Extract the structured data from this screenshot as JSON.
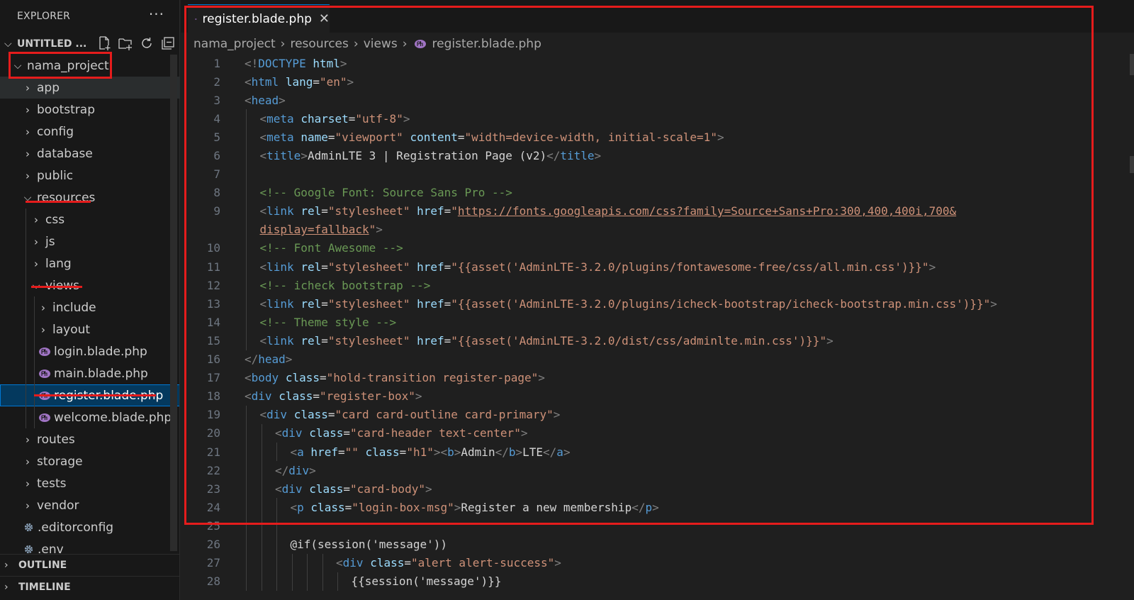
{
  "explorer": {
    "title": "EXPLORER",
    "more_label": "···",
    "workspace_name": "UNTITLED ...",
    "tree": [
      {
        "label": "nama_project",
        "kind": "folder",
        "open": true,
        "depth": 0
      },
      {
        "label": "app",
        "kind": "folder",
        "open": false,
        "depth": 1
      },
      {
        "label": "bootstrap",
        "kind": "folder",
        "open": false,
        "depth": 1
      },
      {
        "label": "config",
        "kind": "folder",
        "open": false,
        "depth": 1
      },
      {
        "label": "database",
        "kind": "folder",
        "open": false,
        "depth": 1
      },
      {
        "label": "public",
        "kind": "folder",
        "open": false,
        "depth": 1
      },
      {
        "label": "resources",
        "kind": "folder",
        "open": true,
        "depth": 1
      },
      {
        "label": "css",
        "kind": "folder",
        "open": false,
        "depth": 2
      },
      {
        "label": "js",
        "kind": "folder",
        "open": false,
        "depth": 2
      },
      {
        "label": "lang",
        "kind": "folder",
        "open": false,
        "depth": 2
      },
      {
        "label": "views",
        "kind": "folder",
        "open": true,
        "depth": 2
      },
      {
        "label": "include",
        "kind": "folder",
        "open": false,
        "depth": 3
      },
      {
        "label": "layout",
        "kind": "folder",
        "open": false,
        "depth": 3
      },
      {
        "label": "login.blade.php",
        "kind": "php",
        "depth": 3
      },
      {
        "label": "main.blade.php",
        "kind": "php",
        "depth": 3
      },
      {
        "label": "register.blade.php",
        "kind": "php",
        "depth": 3,
        "selected": true
      },
      {
        "label": "welcome.blade.php",
        "kind": "php",
        "depth": 3
      },
      {
        "label": "routes",
        "kind": "folder",
        "open": false,
        "depth": 1
      },
      {
        "label": "storage",
        "kind": "folder",
        "open": false,
        "depth": 1
      },
      {
        "label": "tests",
        "kind": "folder",
        "open": false,
        "depth": 1
      },
      {
        "label": "vendor",
        "kind": "folder",
        "open": false,
        "depth": 1
      },
      {
        "label": ".editorconfig",
        "kind": "config",
        "depth": 1
      },
      {
        "label": ".env",
        "kind": "config",
        "depth": 1
      }
    ],
    "outline_label": "OUTLINE",
    "timeline_label": "TIMELINE"
  },
  "editor": {
    "tab_label": "register.blade.php",
    "tab_close": "✕",
    "breadcrumb": [
      "nama_project",
      "resources",
      "views",
      "register.blade.php"
    ],
    "lines": [
      {
        "n": "1",
        "indent": 0,
        "tokens": [
          [
            "p",
            "<!"
          ],
          [
            "t",
            "DOCTYPE"
          ],
          [
            "x",
            " "
          ],
          [
            "a",
            "html"
          ],
          [
            "p",
            ">"
          ]
        ]
      },
      {
        "n": "2",
        "indent": 0,
        "tokens": [
          [
            "p",
            "<"
          ],
          [
            "t",
            "html"
          ],
          [
            "x",
            " "
          ],
          [
            "a",
            "lang"
          ],
          [
            "x",
            "="
          ],
          [
            "s",
            "\"en\""
          ],
          [
            "p",
            ">"
          ]
        ]
      },
      {
        "n": "3",
        "indent": 0,
        "tokens": [
          [
            "p",
            "<"
          ],
          [
            "t",
            "head"
          ],
          [
            "p",
            ">"
          ]
        ]
      },
      {
        "n": "4",
        "indent": 1,
        "tokens": [
          [
            "p",
            "<"
          ],
          [
            "t",
            "meta"
          ],
          [
            "x",
            " "
          ],
          [
            "a",
            "charset"
          ],
          [
            "x",
            "="
          ],
          [
            "s",
            "\"utf-8\""
          ],
          [
            "p",
            ">"
          ]
        ]
      },
      {
        "n": "5",
        "indent": 1,
        "tokens": [
          [
            "p",
            "<"
          ],
          [
            "t",
            "meta"
          ],
          [
            "x",
            " "
          ],
          [
            "a",
            "name"
          ],
          [
            "x",
            "="
          ],
          [
            "s",
            "\"viewport\""
          ],
          [
            "x",
            " "
          ],
          [
            "a",
            "content"
          ],
          [
            "x",
            "="
          ],
          [
            "s",
            "\"width=device-width, initial-scale=1\""
          ],
          [
            "p",
            ">"
          ]
        ]
      },
      {
        "n": "6",
        "indent": 1,
        "tokens": [
          [
            "p",
            "<"
          ],
          [
            "t",
            "title"
          ],
          [
            "p",
            ">"
          ],
          [
            "x",
            "AdminLTE 3 | Registration Page (v2)"
          ],
          [
            "p",
            "</"
          ],
          [
            "t",
            "title"
          ],
          [
            "p",
            ">"
          ]
        ]
      },
      {
        "n": "7",
        "indent": 1,
        "tokens": []
      },
      {
        "n": "8",
        "indent": 1,
        "tokens": [
          [
            "c",
            "<!-- Google Font: Source Sans Pro -->"
          ]
        ]
      },
      {
        "n": "9",
        "indent": 1,
        "tokens": [
          [
            "p",
            "<"
          ],
          [
            "t",
            "link"
          ],
          [
            "x",
            " "
          ],
          [
            "a",
            "rel"
          ],
          [
            "x",
            "="
          ],
          [
            "s",
            "\"stylesheet\""
          ],
          [
            "x",
            " "
          ],
          [
            "a",
            "href"
          ],
          [
            "x",
            "="
          ],
          [
            "s",
            "\""
          ],
          [
            "u",
            "https://fonts.googleapis.com/css?family=Source+Sans+Pro:300,400,400i,700&"
          ]
        ]
      },
      {
        "n": "",
        "indent": 1,
        "tokens": [
          [
            "u",
            "display=fallback"
          ],
          [
            "s",
            "\""
          ],
          [
            "p",
            ">"
          ]
        ]
      },
      {
        "n": "10",
        "indent": 1,
        "tokens": [
          [
            "c",
            "<!-- Font Awesome -->"
          ]
        ]
      },
      {
        "n": "11",
        "indent": 1,
        "tokens": [
          [
            "p",
            "<"
          ],
          [
            "t",
            "link"
          ],
          [
            "x",
            " "
          ],
          [
            "a",
            "rel"
          ],
          [
            "x",
            "="
          ],
          [
            "s",
            "\"stylesheet\""
          ],
          [
            "x",
            " "
          ],
          [
            "a",
            "href"
          ],
          [
            "x",
            "="
          ],
          [
            "s",
            "\"{{asset('AdminLTE-3.2.0/plugins/fontawesome-free/css/all.min.css')}}\""
          ],
          [
            "p",
            ">"
          ]
        ]
      },
      {
        "n": "12",
        "indent": 1,
        "tokens": [
          [
            "c",
            "<!-- icheck bootstrap -->"
          ]
        ]
      },
      {
        "n": "13",
        "indent": 1,
        "tokens": [
          [
            "p",
            "<"
          ],
          [
            "t",
            "link"
          ],
          [
            "x",
            " "
          ],
          [
            "a",
            "rel"
          ],
          [
            "x",
            "="
          ],
          [
            "s",
            "\"stylesheet\""
          ],
          [
            "x",
            " "
          ],
          [
            "a",
            "href"
          ],
          [
            "x",
            "="
          ],
          [
            "s",
            "\"{{asset('AdminLTE-3.2.0/plugins/icheck-bootstrap/icheck-bootstrap.min.css')}}\""
          ],
          [
            "p",
            ">"
          ]
        ]
      },
      {
        "n": "14",
        "indent": 1,
        "tokens": [
          [
            "c",
            "<!-- Theme style -->"
          ]
        ]
      },
      {
        "n": "15",
        "indent": 1,
        "tokens": [
          [
            "p",
            "<"
          ],
          [
            "t",
            "link"
          ],
          [
            "x",
            " "
          ],
          [
            "a",
            "rel"
          ],
          [
            "x",
            "="
          ],
          [
            "s",
            "\"stylesheet\""
          ],
          [
            "x",
            " "
          ],
          [
            "a",
            "href"
          ],
          [
            "x",
            "="
          ],
          [
            "s",
            "\"{{asset('AdminLTE-3.2.0/dist/css/adminlte.min.css')}}\""
          ],
          [
            "p",
            ">"
          ]
        ]
      },
      {
        "n": "16",
        "indent": 0,
        "tokens": [
          [
            "p",
            "</"
          ],
          [
            "t",
            "head"
          ],
          [
            "p",
            ">"
          ]
        ]
      },
      {
        "n": "17",
        "indent": 0,
        "tokens": [
          [
            "p",
            "<"
          ],
          [
            "t",
            "body"
          ],
          [
            "x",
            " "
          ],
          [
            "a",
            "class"
          ],
          [
            "x",
            "="
          ],
          [
            "s",
            "\"hold-transition register-page\""
          ],
          [
            "p",
            ">"
          ]
        ]
      },
      {
        "n": "18",
        "indent": 0,
        "tokens": [
          [
            "p",
            "<"
          ],
          [
            "t",
            "div"
          ],
          [
            "x",
            " "
          ],
          [
            "a",
            "class"
          ],
          [
            "x",
            "="
          ],
          [
            "s",
            "\"register-box\""
          ],
          [
            "p",
            ">"
          ]
        ]
      },
      {
        "n": "19",
        "indent": 1,
        "tokens": [
          [
            "p",
            "<"
          ],
          [
            "t",
            "div"
          ],
          [
            "x",
            " "
          ],
          [
            "a",
            "class"
          ],
          [
            "x",
            "="
          ],
          [
            "s",
            "\"card card-outline card-primary\""
          ],
          [
            "p",
            ">"
          ]
        ]
      },
      {
        "n": "20",
        "indent": 2,
        "tokens": [
          [
            "p",
            "<"
          ],
          [
            "t",
            "div"
          ],
          [
            "x",
            " "
          ],
          [
            "a",
            "class"
          ],
          [
            "x",
            "="
          ],
          [
            "s",
            "\"card-header text-center\""
          ],
          [
            "p",
            ">"
          ]
        ]
      },
      {
        "n": "21",
        "indent": 3,
        "tokens": [
          [
            "p",
            "<"
          ],
          [
            "t",
            "a"
          ],
          [
            "x",
            " "
          ],
          [
            "a",
            "href"
          ],
          [
            "x",
            "="
          ],
          [
            "s",
            "\"\""
          ],
          [
            "x",
            " "
          ],
          [
            "a",
            "class"
          ],
          [
            "x",
            "="
          ],
          [
            "s",
            "\"h1\""
          ],
          [
            "p",
            ">"
          ],
          [
            "p",
            "<"
          ],
          [
            "t",
            "b"
          ],
          [
            "p",
            ">"
          ],
          [
            "x",
            "Admin"
          ],
          [
            "p",
            "</"
          ],
          [
            "t",
            "b"
          ],
          [
            "p",
            ">"
          ],
          [
            "x",
            "LTE"
          ],
          [
            "p",
            "</"
          ],
          [
            "t",
            "a"
          ],
          [
            "p",
            ">"
          ]
        ]
      },
      {
        "n": "22",
        "indent": 2,
        "tokens": [
          [
            "p",
            "</"
          ],
          [
            "t",
            "div"
          ],
          [
            "p",
            ">"
          ]
        ]
      },
      {
        "n": "23",
        "indent": 2,
        "tokens": [
          [
            "p",
            "<"
          ],
          [
            "t",
            "div"
          ],
          [
            "x",
            " "
          ],
          [
            "a",
            "class"
          ],
          [
            "x",
            "="
          ],
          [
            "s",
            "\"card-body\""
          ],
          [
            "p",
            ">"
          ]
        ]
      },
      {
        "n": "24",
        "indent": 3,
        "tokens": [
          [
            "p",
            "<"
          ],
          [
            "t",
            "p"
          ],
          [
            "x",
            " "
          ],
          [
            "a",
            "class"
          ],
          [
            "x",
            "="
          ],
          [
            "s",
            "\"login-box-msg\""
          ],
          [
            "p",
            ">"
          ],
          [
            "x",
            "Register a new membership"
          ],
          [
            "p",
            "</"
          ],
          [
            "t",
            "p"
          ],
          [
            "p",
            ">"
          ]
        ]
      },
      {
        "n": "25",
        "indent": 3,
        "tokens": []
      },
      {
        "n": "26",
        "indent": 3,
        "tokens": [
          [
            "x",
            "@if(session('message'))"
          ]
        ]
      },
      {
        "n": "27",
        "indent": 6,
        "tokens": [
          [
            "p",
            "<"
          ],
          [
            "t",
            "div"
          ],
          [
            "x",
            " "
          ],
          [
            "a",
            "class"
          ],
          [
            "x",
            "="
          ],
          [
            "s",
            "\"alert alert-success\""
          ],
          [
            "p",
            ">"
          ]
        ]
      },
      {
        "n": "28",
        "indent": 7,
        "tokens": [
          [
            "x",
            "{{session('message')}}"
          ]
        ]
      }
    ]
  },
  "colors": {
    "highlight_red": "#e51c1c",
    "selection_blue": "#04395e",
    "php_icon": "#a074c4"
  }
}
